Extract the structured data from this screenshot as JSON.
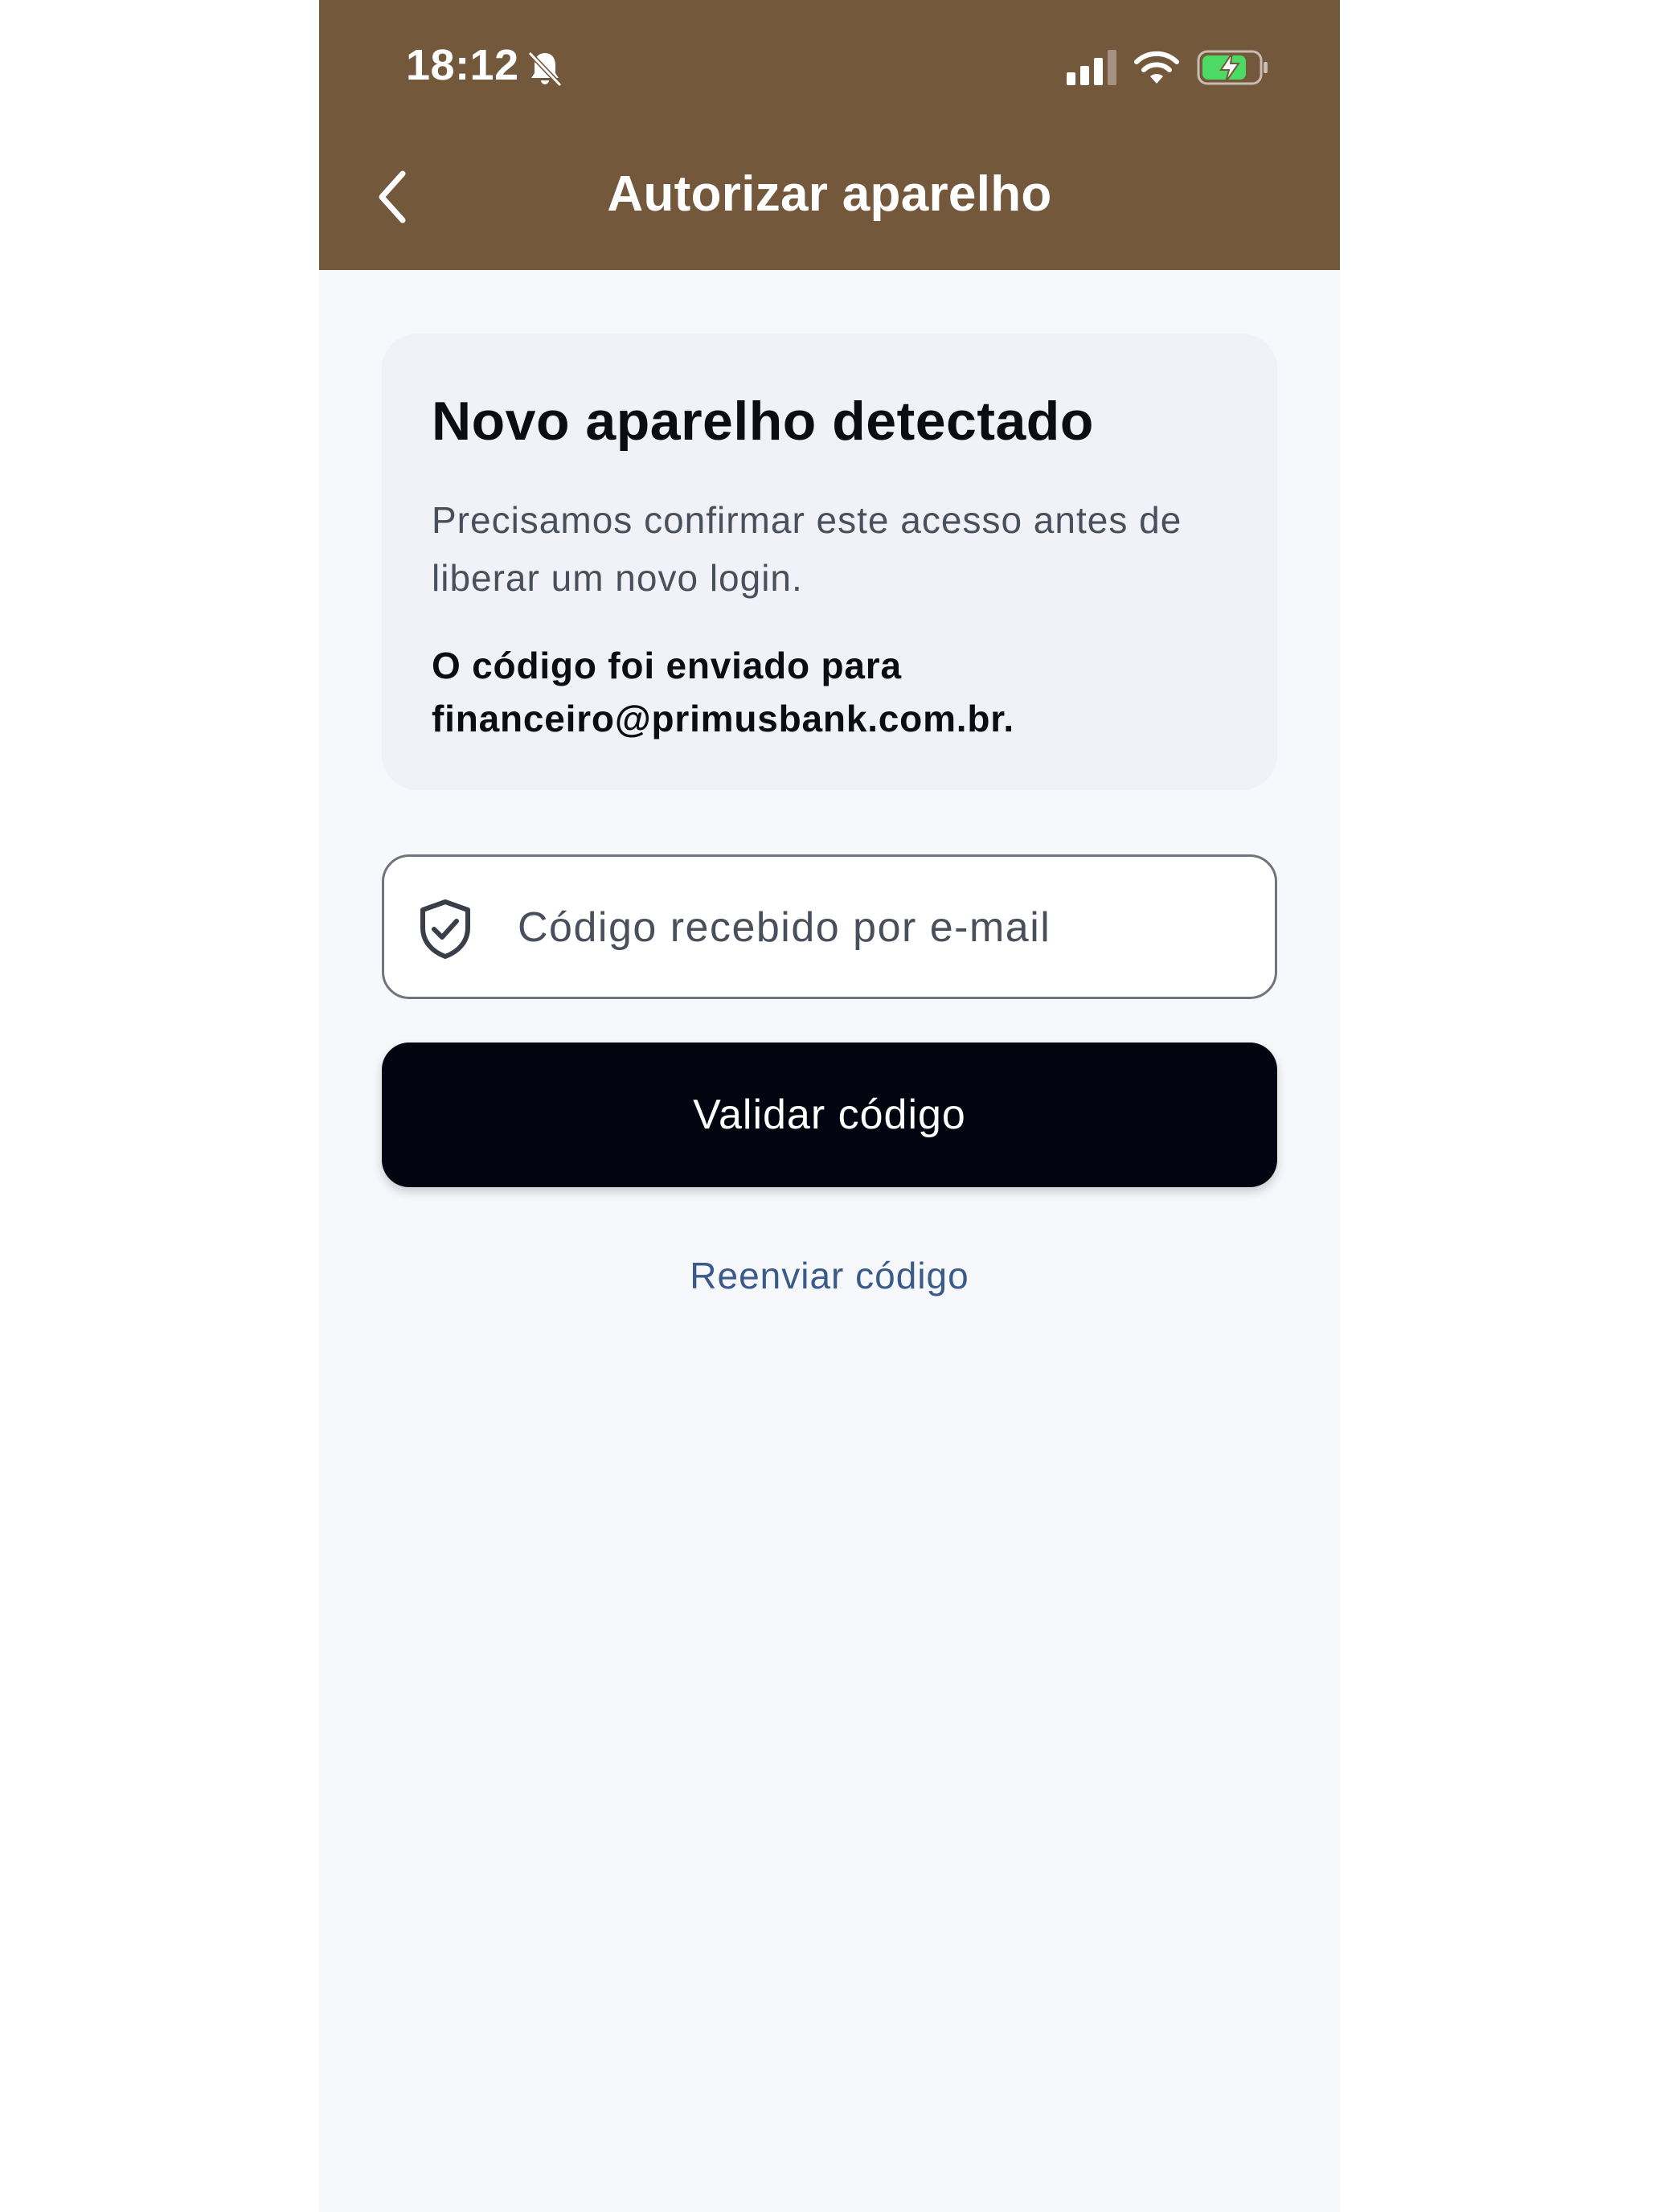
{
  "status_bar": {
    "time": "18:12",
    "icons": [
      "bell-slash-icon",
      "cellular-signal-icon",
      "wifi-icon",
      "battery-charging-icon"
    ]
  },
  "header": {
    "title": "Autorizar aparelho",
    "back_icon": "chevron-left-icon",
    "background_color": "#73583c"
  },
  "card": {
    "title": "Novo aparelho detectado",
    "description": "Precisamos confirmar este acesso antes de liberar um novo login.",
    "sent_to": "O código foi enviado para financeiro@primusbank.com.br."
  },
  "code_field": {
    "icon": "shield-check-icon",
    "placeholder": "Código recebido por e-mail",
    "value": ""
  },
  "validate_button": {
    "label": "Validar código",
    "background_color": "#020410"
  },
  "resend_link": {
    "label": "Reenviar código",
    "color": "#3a5a8a"
  }
}
